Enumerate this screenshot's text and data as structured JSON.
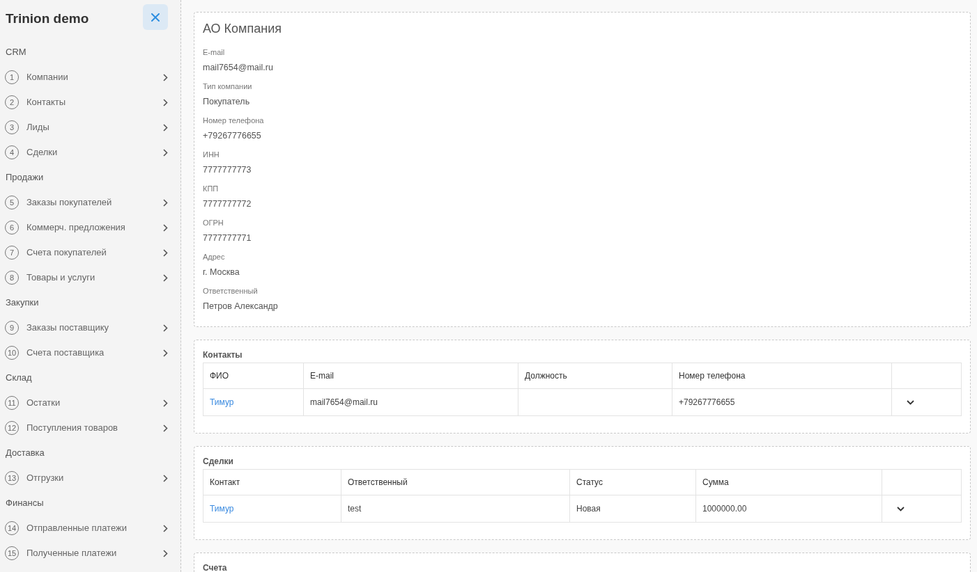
{
  "sidebar": {
    "title": "Trinion demo",
    "sections": [
      {
        "title": "CRM",
        "items": [
          {
            "number": "1",
            "label": "Компании"
          },
          {
            "number": "2",
            "label": "Контакты"
          },
          {
            "number": "3",
            "label": "Лиды"
          },
          {
            "number": "4",
            "label": "Сделки"
          }
        ]
      },
      {
        "title": "Продажи",
        "items": [
          {
            "number": "5",
            "label": "Заказы покупателей"
          },
          {
            "number": "6",
            "label": "Коммерч. предложения"
          },
          {
            "number": "7",
            "label": "Счета покупателей"
          },
          {
            "number": "8",
            "label": "Товары и услуги"
          }
        ]
      },
      {
        "title": "Закупки",
        "items": [
          {
            "number": "9",
            "label": "Заказы поставщику"
          },
          {
            "number": "10",
            "label": "Счета поставщика"
          }
        ]
      },
      {
        "title": "Склад",
        "items": [
          {
            "number": "11",
            "label": "Остатки"
          },
          {
            "number": "12",
            "label": "Поступления товаров"
          }
        ]
      },
      {
        "title": "Доставка",
        "items": [
          {
            "number": "13",
            "label": "Отгрузки"
          }
        ]
      },
      {
        "title": "Финансы",
        "items": [
          {
            "number": "14",
            "label": "Отправленные платежи"
          },
          {
            "number": "15",
            "label": "Полученные платежи"
          }
        ]
      }
    ]
  },
  "company": {
    "title": "АО Компания",
    "fields": [
      {
        "label": "E-mail",
        "value": "mail7654@mail.ru"
      },
      {
        "label": "Тип компании",
        "value": "Покупатель"
      },
      {
        "label": "Номер телефона",
        "value": "+79267776655"
      },
      {
        "label": "ИНН",
        "value": "7777777773"
      },
      {
        "label": "КПП",
        "value": "7777777772"
      },
      {
        "label": "ОГРН",
        "value": "7777777771"
      },
      {
        "label": "Адрес",
        "value": "г. Москва"
      },
      {
        "label": "Ответственный",
        "value": "Петров Александр"
      }
    ]
  },
  "sections": [
    {
      "title": "Контакты",
      "columns": [
        "ФИО",
        "E-mail",
        "Должность",
        "Номер телефона",
        ""
      ],
      "rows": [
        {
          "cells": [
            {
              "kind": "link",
              "text": "Тимур"
            },
            {
              "kind": "text",
              "text": "mail7654@mail.ru"
            },
            {
              "kind": "empty"
            },
            {
              "kind": "text",
              "text": "+79267776655"
            }
          ]
        }
      ]
    },
    {
      "title": "Сделки",
      "columns": [
        "Контакт",
        "Ответственный",
        "Статус",
        "Сумма",
        ""
      ],
      "rows": [
        {
          "cells": [
            {
              "kind": "link",
              "text": "Тимур"
            },
            {
              "kind": "text",
              "text": "test"
            },
            {
              "kind": "text",
              "text": "Новая"
            },
            {
              "kind": "text",
              "text": "1000000.00"
            }
          ]
        }
      ]
    },
    {
      "title": "Счета"
    }
  ]
}
